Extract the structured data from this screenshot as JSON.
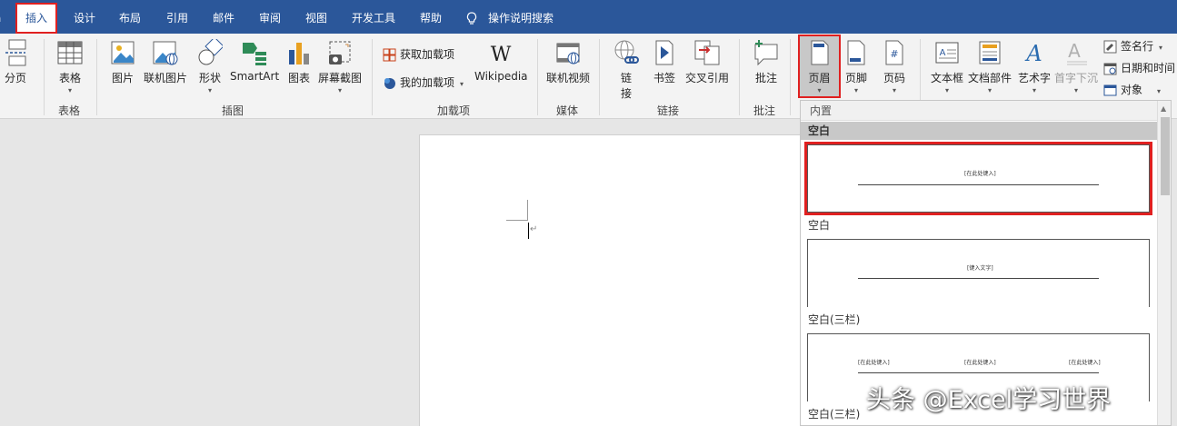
{
  "tabs": [
    {
      "label": "插入",
      "active": true
    },
    {
      "label": "设计"
    },
    {
      "label": "布局"
    },
    {
      "label": "引用"
    },
    {
      "label": "邮件"
    },
    {
      "label": "审阅"
    },
    {
      "label": "视图"
    },
    {
      "label": "开发工具"
    },
    {
      "label": "帮助"
    }
  ],
  "tell_me": "操作说明搜索",
  "ribbon": {
    "pages": {
      "page_break": "分页"
    },
    "tables": {
      "table": "表格",
      "group": "表格"
    },
    "illustrations": {
      "picture": "图片",
      "online_picture": "联机图片",
      "shapes": "形状",
      "smartart": "SmartArt",
      "chart": "图表",
      "screenshot": "屏幕截图",
      "group": "插图"
    },
    "addins": {
      "get_addins": "获取加载项",
      "my_addins": "我的加载项",
      "wikipedia": "Wikipedia",
      "group": "加载项"
    },
    "media": {
      "online_video": "联机视频",
      "group": "媒体"
    },
    "links": {
      "link_line1": "链",
      "link_line2": "接",
      "bookmark": "书签",
      "cross_ref": "交叉引用",
      "group": "链接"
    },
    "comments": {
      "comment": "批注",
      "group": "批注"
    },
    "header_footer": {
      "header": "页眉",
      "footer": "页脚",
      "page_number": "页码"
    },
    "text": {
      "textbox": "文本框",
      "quick_parts": "文档部件",
      "wordart": "艺术字",
      "dropcap": "首字下沉",
      "signature": "签名行",
      "datetime": "日期和时间",
      "object": "对象"
    }
  },
  "gallery": {
    "heading": "内置",
    "items": [
      {
        "title": "空白",
        "placeholder": "[在此处键入]"
      },
      {
        "title": "空白",
        "placeholder": "[键入文字]"
      },
      {
        "title": "空白(三栏)",
        "placeholders": [
          "[在此处键入]",
          "[在此处键入]",
          "[在此处键入]"
        ]
      },
      {
        "title": "空白(三栏)"
      }
    ]
  },
  "watermark": "头条 @Excel学习世界",
  "colors": {
    "accent": "#2b579a",
    "highlight": "#e02020"
  }
}
